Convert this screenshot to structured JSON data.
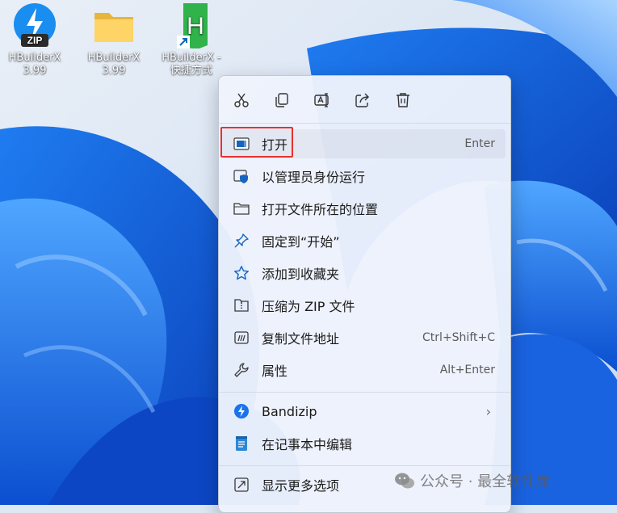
{
  "desktop": {
    "icons": [
      {
        "label": "HBuilderX\n3.99",
        "icon": "bandizip-zip-icon",
        "badge": "ZIP"
      },
      {
        "label": "HBuilderX\n3.99",
        "icon": "folder-icon"
      },
      {
        "label": "HBuilderX -\n快捷方式",
        "icon": "hbuilderx-app-icon",
        "glyph": "H",
        "shortcut": true
      }
    ]
  },
  "context_menu": {
    "quick_actions": [
      {
        "name": "cut",
        "icon": "scissors-icon"
      },
      {
        "name": "copy",
        "icon": "copy-icon"
      },
      {
        "name": "rename",
        "icon": "rename-icon"
      },
      {
        "name": "share",
        "icon": "share-icon"
      },
      {
        "name": "delete",
        "icon": "trash-icon"
      }
    ],
    "items": [
      {
        "label": "打开",
        "shortcut": "Enter",
        "icon": "open-window-icon"
      },
      {
        "label": "以管理员身份运行",
        "shortcut": "",
        "icon": "shield-admin-icon"
      },
      {
        "label": "打开文件所在的位置",
        "shortcut": "",
        "icon": "folder-outline-icon"
      },
      {
        "label": "固定到“开始”",
        "shortcut": "",
        "icon": "pin-icon"
      },
      {
        "label": "添加到收藏夹",
        "shortcut": "",
        "icon": "star-icon"
      },
      {
        "label": "压缩为 ZIP 文件",
        "shortcut": "",
        "icon": "zip-file-icon"
      },
      {
        "label": "复制文件地址",
        "shortcut": "Ctrl+Shift+C",
        "icon": "copy-path-icon"
      },
      {
        "label": "属性",
        "shortcut": "Alt+Enter",
        "icon": "wrench-icon"
      },
      {
        "label": "Bandizip",
        "shortcut": "",
        "icon": "bandizip-icon",
        "submenu": true
      },
      {
        "label": "在记事本中编辑",
        "shortcut": "",
        "icon": "notepad-icon"
      },
      {
        "label": "显示更多选项",
        "shortcut": "",
        "icon": "more-options-icon"
      }
    ]
  },
  "watermark": {
    "text": "公众号 · 最全软件库"
  },
  "colors": {
    "highlight": "#e5322d",
    "accent": "#0067c0",
    "hbuilder_green": "#2fb34a"
  }
}
